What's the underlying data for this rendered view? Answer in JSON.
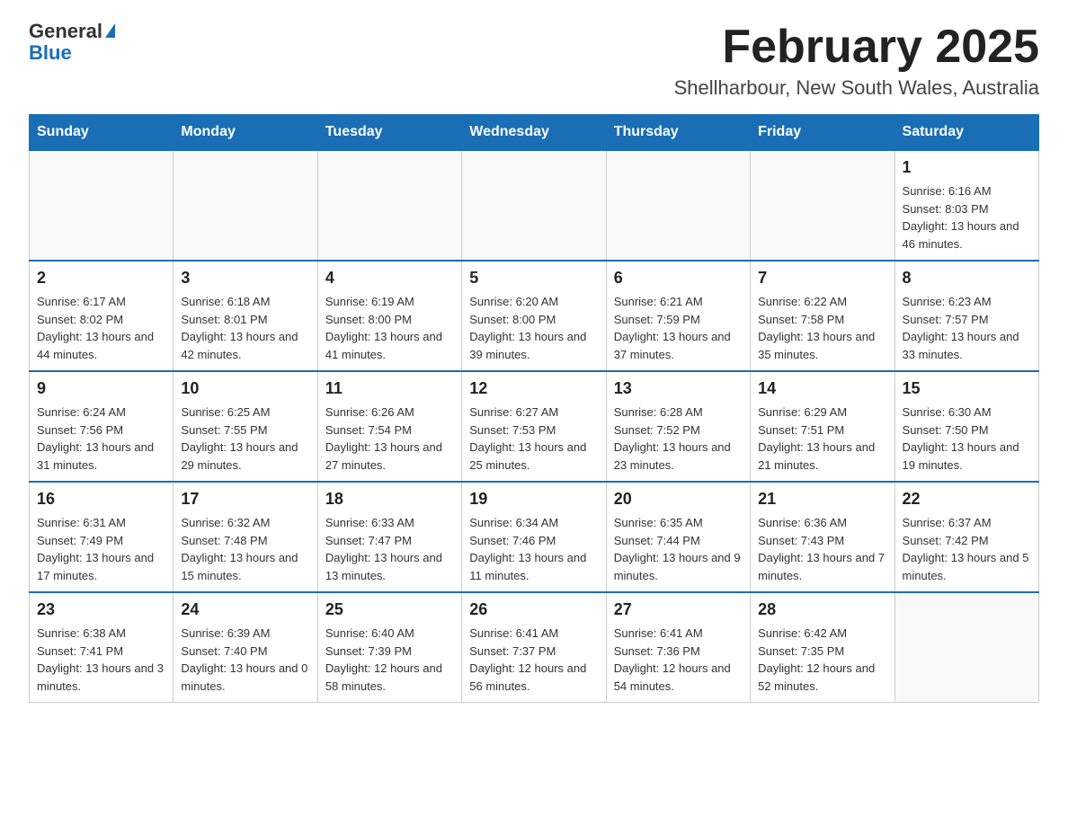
{
  "header": {
    "logo_general": "General",
    "logo_blue": "Blue",
    "month_title": "February 2025",
    "location": "Shellharbour, New South Wales, Australia"
  },
  "days_of_week": [
    "Sunday",
    "Monday",
    "Tuesday",
    "Wednesday",
    "Thursday",
    "Friday",
    "Saturday"
  ],
  "weeks": [
    [
      {
        "day": "",
        "info": ""
      },
      {
        "day": "",
        "info": ""
      },
      {
        "day": "",
        "info": ""
      },
      {
        "day": "",
        "info": ""
      },
      {
        "day": "",
        "info": ""
      },
      {
        "day": "",
        "info": ""
      },
      {
        "day": "1",
        "info": "Sunrise: 6:16 AM\nSunset: 8:03 PM\nDaylight: 13 hours and 46 minutes."
      }
    ],
    [
      {
        "day": "2",
        "info": "Sunrise: 6:17 AM\nSunset: 8:02 PM\nDaylight: 13 hours and 44 minutes."
      },
      {
        "day": "3",
        "info": "Sunrise: 6:18 AM\nSunset: 8:01 PM\nDaylight: 13 hours and 42 minutes."
      },
      {
        "day": "4",
        "info": "Sunrise: 6:19 AM\nSunset: 8:00 PM\nDaylight: 13 hours and 41 minutes."
      },
      {
        "day": "5",
        "info": "Sunrise: 6:20 AM\nSunset: 8:00 PM\nDaylight: 13 hours and 39 minutes."
      },
      {
        "day": "6",
        "info": "Sunrise: 6:21 AM\nSunset: 7:59 PM\nDaylight: 13 hours and 37 minutes."
      },
      {
        "day": "7",
        "info": "Sunrise: 6:22 AM\nSunset: 7:58 PM\nDaylight: 13 hours and 35 minutes."
      },
      {
        "day": "8",
        "info": "Sunrise: 6:23 AM\nSunset: 7:57 PM\nDaylight: 13 hours and 33 minutes."
      }
    ],
    [
      {
        "day": "9",
        "info": "Sunrise: 6:24 AM\nSunset: 7:56 PM\nDaylight: 13 hours and 31 minutes."
      },
      {
        "day": "10",
        "info": "Sunrise: 6:25 AM\nSunset: 7:55 PM\nDaylight: 13 hours and 29 minutes."
      },
      {
        "day": "11",
        "info": "Sunrise: 6:26 AM\nSunset: 7:54 PM\nDaylight: 13 hours and 27 minutes."
      },
      {
        "day": "12",
        "info": "Sunrise: 6:27 AM\nSunset: 7:53 PM\nDaylight: 13 hours and 25 minutes."
      },
      {
        "day": "13",
        "info": "Sunrise: 6:28 AM\nSunset: 7:52 PM\nDaylight: 13 hours and 23 minutes."
      },
      {
        "day": "14",
        "info": "Sunrise: 6:29 AM\nSunset: 7:51 PM\nDaylight: 13 hours and 21 minutes."
      },
      {
        "day": "15",
        "info": "Sunrise: 6:30 AM\nSunset: 7:50 PM\nDaylight: 13 hours and 19 minutes."
      }
    ],
    [
      {
        "day": "16",
        "info": "Sunrise: 6:31 AM\nSunset: 7:49 PM\nDaylight: 13 hours and 17 minutes."
      },
      {
        "day": "17",
        "info": "Sunrise: 6:32 AM\nSunset: 7:48 PM\nDaylight: 13 hours and 15 minutes."
      },
      {
        "day": "18",
        "info": "Sunrise: 6:33 AM\nSunset: 7:47 PM\nDaylight: 13 hours and 13 minutes."
      },
      {
        "day": "19",
        "info": "Sunrise: 6:34 AM\nSunset: 7:46 PM\nDaylight: 13 hours and 11 minutes."
      },
      {
        "day": "20",
        "info": "Sunrise: 6:35 AM\nSunset: 7:44 PM\nDaylight: 13 hours and 9 minutes."
      },
      {
        "day": "21",
        "info": "Sunrise: 6:36 AM\nSunset: 7:43 PM\nDaylight: 13 hours and 7 minutes."
      },
      {
        "day": "22",
        "info": "Sunrise: 6:37 AM\nSunset: 7:42 PM\nDaylight: 13 hours and 5 minutes."
      }
    ],
    [
      {
        "day": "23",
        "info": "Sunrise: 6:38 AM\nSunset: 7:41 PM\nDaylight: 13 hours and 3 minutes."
      },
      {
        "day": "24",
        "info": "Sunrise: 6:39 AM\nSunset: 7:40 PM\nDaylight: 13 hours and 0 minutes."
      },
      {
        "day": "25",
        "info": "Sunrise: 6:40 AM\nSunset: 7:39 PM\nDaylight: 12 hours and 58 minutes."
      },
      {
        "day": "26",
        "info": "Sunrise: 6:41 AM\nSunset: 7:37 PM\nDaylight: 12 hours and 56 minutes."
      },
      {
        "day": "27",
        "info": "Sunrise: 6:41 AM\nSunset: 7:36 PM\nDaylight: 12 hours and 54 minutes."
      },
      {
        "day": "28",
        "info": "Sunrise: 6:42 AM\nSunset: 7:35 PM\nDaylight: 12 hours and 52 minutes."
      },
      {
        "day": "",
        "info": ""
      }
    ]
  ]
}
